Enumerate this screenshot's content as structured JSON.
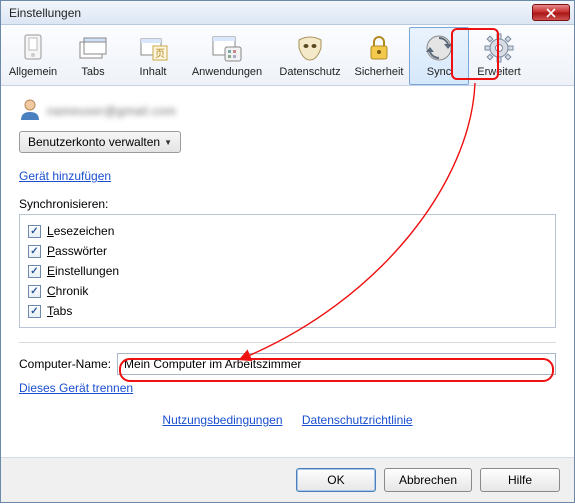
{
  "window": {
    "title": "Einstellungen"
  },
  "toolbar": {
    "items": [
      {
        "label": "Allgemein"
      },
      {
        "label": "Tabs"
      },
      {
        "label": "Inhalt"
      },
      {
        "label": "Anwendungen"
      },
      {
        "label": "Datenschutz"
      },
      {
        "label": "Sicherheit"
      },
      {
        "label": "Sync"
      },
      {
        "label": "Erweitert"
      }
    ]
  },
  "account": {
    "email_obscured": "nameuser@gmail.com",
    "manage_label": "Benutzerkonto verwalten",
    "add_device": "Gerät hinzufügen"
  },
  "sync": {
    "heading": "Synchronisieren:",
    "items": [
      {
        "label": "Lesezeichen",
        "u": "L",
        "rest": "esezeichen",
        "checked": true
      },
      {
        "label": "Passwörter",
        "u": "P",
        "rest": "asswörter",
        "checked": true
      },
      {
        "label": "Einstellungen",
        "u": "E",
        "rest": "instellungen",
        "checked": true
      },
      {
        "label": "Chronik",
        "u": "C",
        "rest": "hronik",
        "checked": true
      },
      {
        "label": "Tabs",
        "u": "T",
        "rest": "abs",
        "checked": true
      }
    ]
  },
  "computer": {
    "label": "Computer-Name:",
    "value": "Mein Computer im Arbeitszimmer",
    "disconnect": "Dieses Gerät trennen"
  },
  "footer": {
    "terms": "Nutzungsbedingungen",
    "privacy": "Datenschutzrichtlinie"
  },
  "buttons": {
    "ok": "OK",
    "cancel": "Abbrechen",
    "help": "Hilfe"
  }
}
